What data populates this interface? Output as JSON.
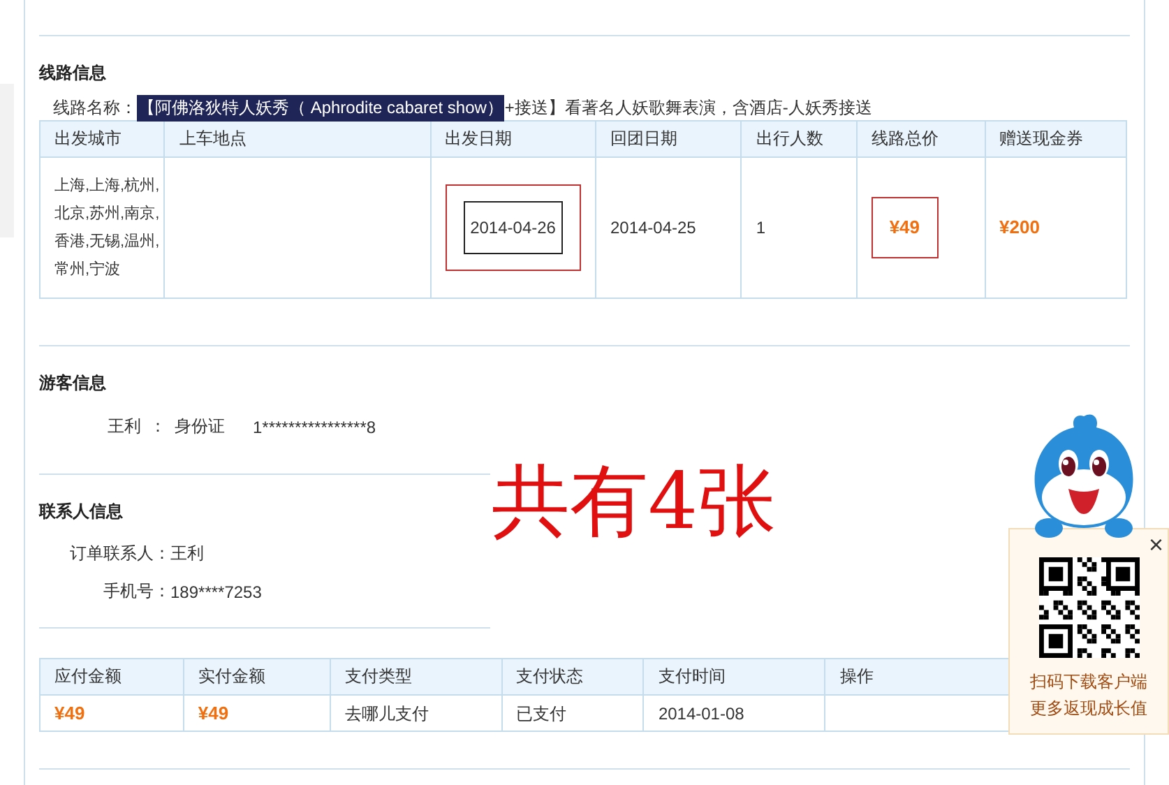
{
  "route_section": {
    "title": "线路信息",
    "name_label": "线路名称：",
    "name_highlight": "【阿佛洛狄特人妖秀（ Aphrodite cabaret show）",
    "name_rest": "+接送】看著名人妖歌舞表演，含酒店-人妖秀接送"
  },
  "route_table": {
    "columns": [
      "出发城市",
      "上车地点",
      "出发日期",
      "回团日期",
      "出行人数",
      "线路总价",
      "赠送现金券"
    ],
    "rows": [
      [
        {
          "text": "上海,上海,杭州,北京,苏州,南京,香港,无锡,温州,常州,宁波",
          "kind": "plain",
          "marked": false
        },
        {
          "kind": "empty"
        },
        {
          "text": "2014-04-26",
          "kind": "boxed",
          "marked": true
        },
        {
          "text": "2014-04-25",
          "kind": "plain",
          "marked": false
        },
        {
          "text": "1",
          "kind": "plain",
          "marked": false
        },
        {
          "text": "¥49",
          "kind": "price",
          "marked": true
        },
        {
          "text": "¥200",
          "kind": "price",
          "marked": false
        }
      ]
    ]
  },
  "traveler_section": {
    "title": "游客信息",
    "name": "王利",
    "separator": "：",
    "id_type": "身份证",
    "id_number": "1****************8"
  },
  "contact_section": {
    "title": "联系人信息",
    "fields": [
      {
        "label": "订单联系人：",
        "value": "王利"
      },
      {
        "label": "手机号：",
        "value": "189****7253"
      }
    ]
  },
  "annotation": "共有4张",
  "payment_table": {
    "columns": [
      "应付金额",
      "实付金额",
      "支付类型",
      "支付状态",
      "支付时间",
      "操作"
    ],
    "rows": [
      [
        {
          "text": "¥49",
          "kind": "price"
        },
        {
          "text": "¥49",
          "kind": "price"
        },
        {
          "text": "去哪儿支付",
          "kind": "plain"
        },
        {
          "text": "已支付",
          "kind": "plain"
        },
        {
          "text": "2014-01-08",
          "kind": "plain"
        },
        {
          "kind": "empty"
        }
      ]
    ]
  },
  "app_popup": {
    "close": "×",
    "lines": [
      "扫码下载客户端",
      "更多返现成长值"
    ]
  }
}
